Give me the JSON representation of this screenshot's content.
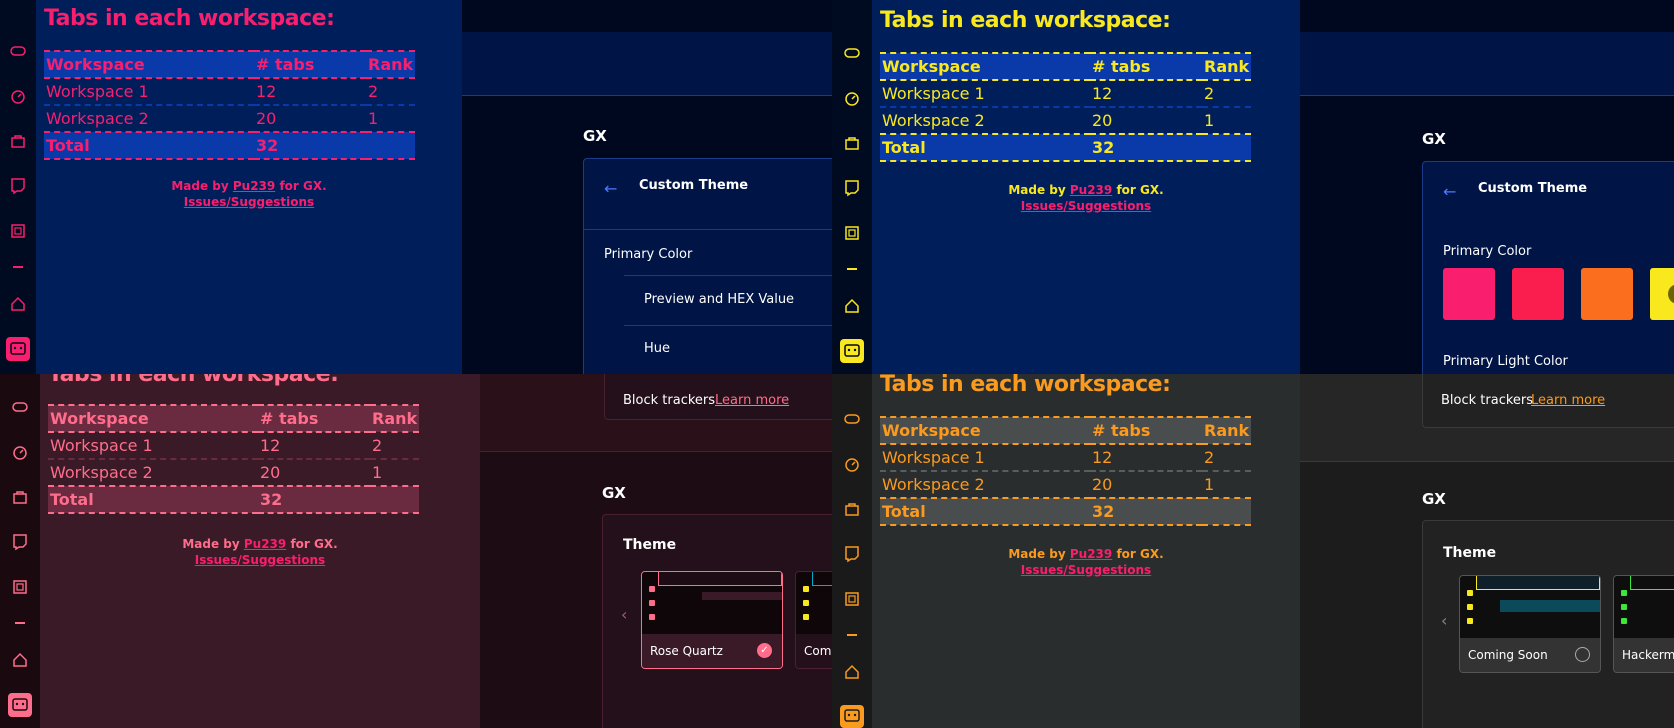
{
  "extension": {
    "title": "Tabs in each workspace:",
    "headers": [
      "Workspace",
      "# tabs",
      "Rank"
    ],
    "rows": [
      {
        "workspace": "Workspace 1",
        "tabs": "12",
        "rank": "2"
      },
      {
        "workspace": "Workspace 2",
        "tabs": "20",
        "rank": "1"
      }
    ],
    "total": {
      "label": "Total",
      "tabs": "32"
    },
    "credits": {
      "made_by": "Made by",
      "author": "Pu239",
      "for_gx": "for GX.",
      "issues": "Issues/Suggestions"
    }
  },
  "rail_icons": [
    "gamepad-icon",
    "speedometer-icon",
    "shopping-bag-icon",
    "twitch-icon",
    "cpu-icon",
    "home-icon",
    "gx-player-icon"
  ],
  "settings_blue": {
    "section": "GX",
    "custom_theme_title": "Custom Theme",
    "primary_color": "Primary Color",
    "preview_hex": "Preview and HEX Value",
    "hue": "Hue"
  },
  "settings_yellow": {
    "section": "GX",
    "custom_theme_title": "Custom Theme",
    "primary_color": "Primary Color",
    "primary_light_color": "Primary Light Color",
    "swatches": [
      "#fa1e6e",
      "#fa1e4e",
      "#fa6e1e",
      "#fae81e"
    ]
  },
  "settings_pink": {
    "block_trackers": "Block trackers",
    "learn_more": "Learn more",
    "section": "GX",
    "theme_title": "Theme",
    "themes": [
      {
        "name": "Rose Quartz",
        "selected": true
      },
      {
        "name": "Com"
      }
    ]
  },
  "settings_orange": {
    "block_trackers": "Block trackers",
    "learn_more": "Learn more",
    "section": "GX",
    "theme_title": "Theme",
    "themes": [
      {
        "name": "Coming Soon",
        "selected": false
      },
      {
        "name": "Hackerma"
      }
    ]
  },
  "palette": {
    "blue_accent": "#fa1e6e",
    "yellow_accent": "#fae81e",
    "pink_accent": "#ff6d8c",
    "orange_accent": "#fa9a1e"
  }
}
